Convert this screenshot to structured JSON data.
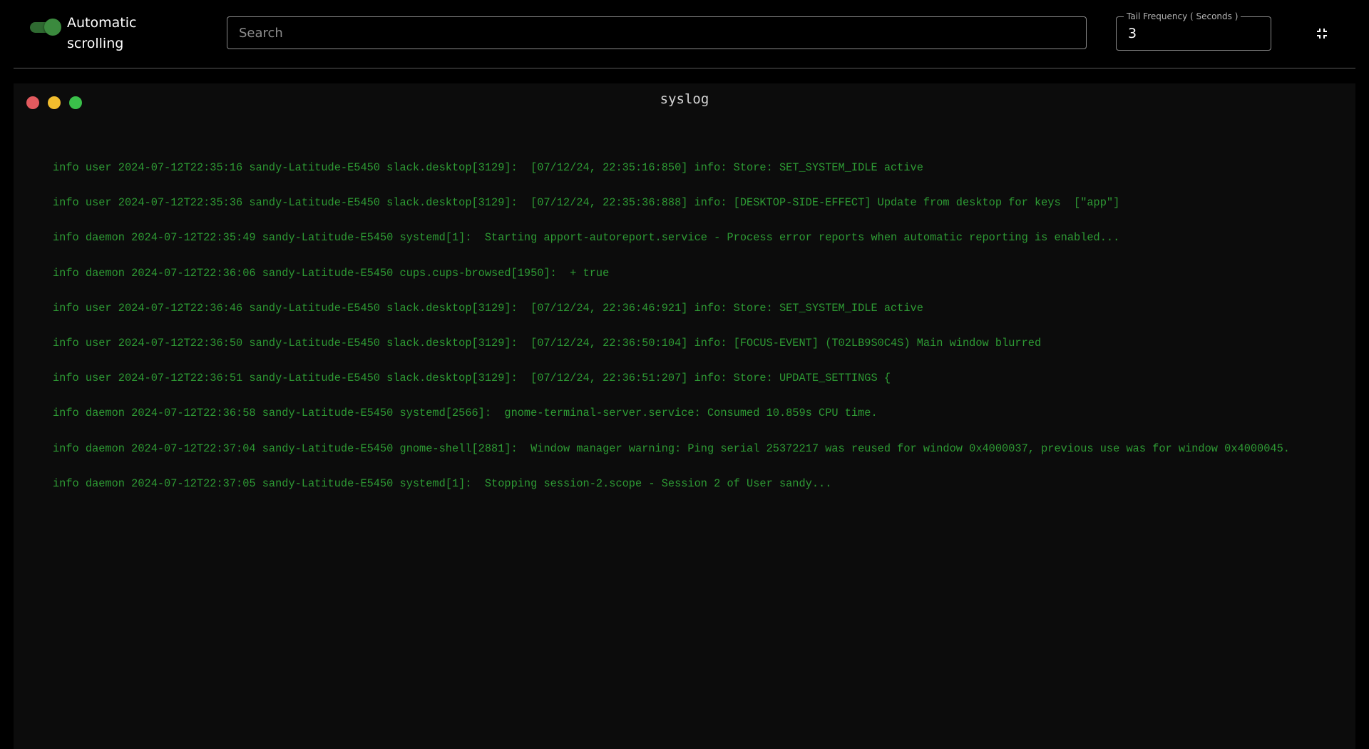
{
  "toolbar": {
    "auto_scroll_label": "Automatic scrolling",
    "auto_scroll_on": true,
    "search_placeholder": "Search",
    "search_value": "",
    "tail_frequency_label": "Tail Frequency ( Seconds )",
    "tail_frequency_value": "3",
    "collapse_icon": "collapse-icon"
  },
  "terminal": {
    "title": "syslog",
    "window_buttons": [
      "close",
      "minimize",
      "maximize"
    ],
    "colors": {
      "close": "#e35a5f",
      "minimize": "#f2bd2e",
      "maximize": "#3ac04a",
      "log_text": "#2e9b34",
      "toggle_accent": "#3b8a3e"
    },
    "lines": [
      "info user 2024-07-12T22:35:16 sandy-Latitude-E5450 slack.desktop[3129]:  [07/12/24, 22:35:16:850] info: Store: SET_SYSTEM_IDLE active",
      "info user 2024-07-12T22:35:36 sandy-Latitude-E5450 slack.desktop[3129]:  [07/12/24, 22:35:36:888] info: [DESKTOP-SIDE-EFFECT] Update from desktop for keys  [\"app\"]",
      "info daemon 2024-07-12T22:35:49 sandy-Latitude-E5450 systemd[1]:  Starting apport-autoreport.service - Process error reports when automatic reporting is enabled...",
      "info daemon 2024-07-12T22:36:06 sandy-Latitude-E5450 cups.cups-browsed[1950]:  + true",
      "info user 2024-07-12T22:36:46 sandy-Latitude-E5450 slack.desktop[3129]:  [07/12/24, 22:36:46:921] info: Store: SET_SYSTEM_IDLE active",
      "info user 2024-07-12T22:36:50 sandy-Latitude-E5450 slack.desktop[3129]:  [07/12/24, 22:36:50:104] info: [FOCUS-EVENT] (T02LB9S0C4S) Main window blurred",
      "info user 2024-07-12T22:36:51 sandy-Latitude-E5450 slack.desktop[3129]:  [07/12/24, 22:36:51:207] info: Store: UPDATE_SETTINGS {",
      "info daemon 2024-07-12T22:36:58 sandy-Latitude-E5450 systemd[2566]:  gnome-terminal-server.service: Consumed 10.859s CPU time.",
      "info daemon 2024-07-12T22:37:04 sandy-Latitude-E5450 gnome-shell[2881]:  Window manager warning: Ping serial 25372217 was reused for window 0x4000037, previous use was for window 0x4000045.",
      "info daemon 2024-07-12T22:37:05 sandy-Latitude-E5450 systemd[1]:  Stopping session-2.scope - Session 2 of User sandy..."
    ]
  }
}
